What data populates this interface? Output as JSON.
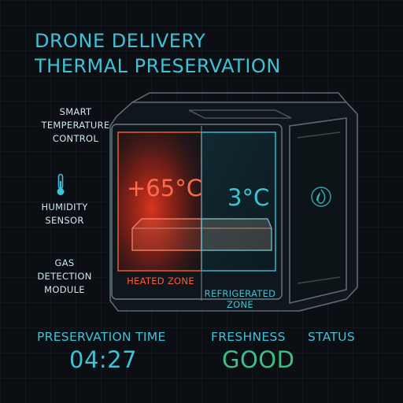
{
  "title": {
    "line1": "DRONE DELIVERY",
    "line2": "THERMAL PRESERVATION"
  },
  "features": [
    {
      "lines": [
        "SMART",
        "TEMPERATURE",
        "CONTROL"
      ]
    },
    {
      "icon": "thermometer-icon",
      "lines": [
        "HUMIDITY",
        "SENSOR"
      ]
    },
    {
      "lines": [
        "GAS",
        "DETECTION",
        "MODULE"
      ]
    }
  ],
  "zones": {
    "heated": {
      "temperature": "+65°C",
      "label": "HEATED ZONE",
      "color": "#ff5a3a"
    },
    "refrigerated": {
      "temperature": "3°C",
      "label_line1": "REFRIGERATED",
      "label_line2": "ZONE",
      "color": "#3fc2d6"
    }
  },
  "side_panel": {
    "icon": "flame-icon"
  },
  "stats": {
    "preservation_time": {
      "label": "PRESERVATION TIME",
      "value": "04:27"
    },
    "freshness": {
      "label": "FRESHNESS",
      "value": "GOOD",
      "color": "#3fbf86"
    },
    "status": {
      "label": "STATUS"
    }
  },
  "colors": {
    "accent": "#3fc2d6",
    "heat": "#ff5a3a",
    "good": "#3fbf86",
    "background": "#0b0f13"
  }
}
